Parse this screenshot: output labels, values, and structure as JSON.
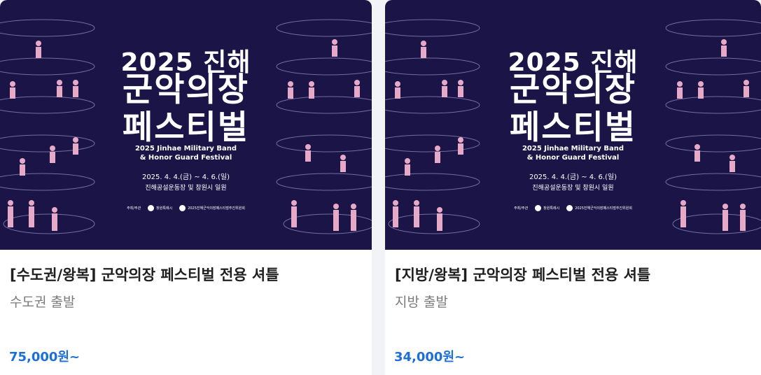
{
  "cards": [
    {
      "poster": {
        "year_line": "2025 진해",
        "title_line1": "군악의장",
        "title_line2": "페스티벌",
        "en_line1": "2025 Jinhae Military Band",
        "en_line2": "& Honor Guard Festival",
        "date": "2025. 4. 4.(금) ~ 4. 6.(일)",
        "venue": "진해공설운동장 및 창원시 일원",
        "org1": "주최/주관",
        "org2": "창원특례시",
        "org3": "2025진해군악의장페스티벌추진위원회"
      },
      "title": "[수도권/왕복] 군악의장 페스티벌 전용 셔틀",
      "subtitle": "수도권 출발",
      "price": "75,000원~"
    },
    {
      "poster": {
        "year_line": "2025 진해",
        "title_line1": "군악의장",
        "title_line2": "페스티벌",
        "en_line1": "2025 Jinhae Military Band",
        "en_line2": "& Honor Guard Festival",
        "date": "2025. 4. 4.(금) ~ 4. 6.(일)",
        "venue": "진해공설운동장 및 창원시 일원",
        "org1": "주최/주관",
        "org2": "창원특례시",
        "org3": "2025진해군악의장페스티벌추진위원회"
      },
      "title": "[지방/왕복] 군악의장 페스티벌 전용 셔틀",
      "subtitle": "지방 출발",
      "price": "34,000원~"
    }
  ],
  "colors": {
    "poster_bg": "#1b1446",
    "figure_pink": "#e7a9c8",
    "price_blue": "#1b6fd8"
  }
}
